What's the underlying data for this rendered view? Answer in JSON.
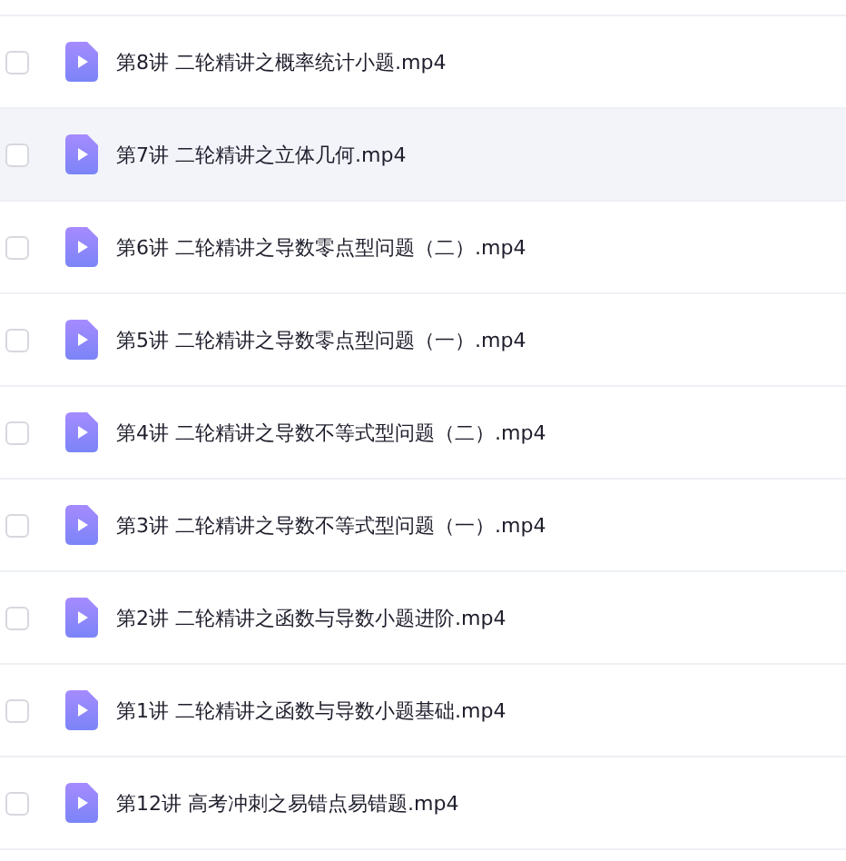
{
  "files": [
    {
      "name": "第8讲 二轮精讲之概率统计小题.mp4",
      "checked": false,
      "highlighted": false
    },
    {
      "name": "第7讲 二轮精讲之立体几何.mp4",
      "checked": false,
      "highlighted": true
    },
    {
      "name": "第6讲 二轮精讲之导数零点型问题（二）.mp4",
      "checked": false,
      "highlighted": false
    },
    {
      "name": "第5讲 二轮精讲之导数零点型问题（一）.mp4",
      "checked": false,
      "highlighted": false
    },
    {
      "name": "第4讲 二轮精讲之导数不等式型问题（二）.mp4",
      "checked": false,
      "highlighted": false
    },
    {
      "name": "第3讲 二轮精讲之导数不等式型问题（一）.mp4",
      "checked": false,
      "highlighted": false
    },
    {
      "name": "第2讲 二轮精讲之函数与导数小题进阶.mp4",
      "checked": false,
      "highlighted": false
    },
    {
      "name": "第1讲 二轮精讲之函数与导数小题基础.mp4",
      "checked": false,
      "highlighted": false
    },
    {
      "name": "第12讲 高考冲刺之易错点易错题.mp4",
      "checked": false,
      "highlighted": false
    }
  ]
}
